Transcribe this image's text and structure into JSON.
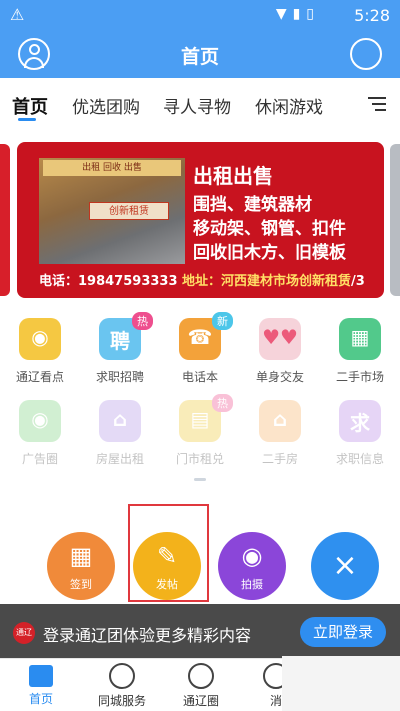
{
  "status": {
    "time": "5:28"
  },
  "header": {
    "title": "首页"
  },
  "tabs": [
    {
      "label": "首页",
      "active": true
    },
    {
      "label": "优选团购"
    },
    {
      "label": "寻人寻物"
    },
    {
      "label": "休闲游戏"
    }
  ],
  "banner": {
    "sign_text": "出租 回收 出售",
    "photo_sign": "创新租赁",
    "headline": "出租出售",
    "lines": [
      "围挡、建筑器材",
      "移动架、钢管、扣件",
      "回收旧木方、旧模板"
    ],
    "phone": "电话：19847593333",
    "address": "地址：河西建材市场创新租赁",
    "page": "/3"
  },
  "grid": [
    {
      "label": "通辽看点",
      "badge": ""
    },
    {
      "label": "求职招聘",
      "badge": "热"
    },
    {
      "label": "电话本",
      "badge": "新"
    },
    {
      "label": "单身交友",
      "badge": ""
    },
    {
      "label": "二手市场",
      "badge": ""
    },
    {
      "label": "广告圈",
      "badge": ""
    },
    {
      "label": "房屋出租",
      "badge": ""
    },
    {
      "label": "门市租兑",
      "badge": "热"
    },
    {
      "label": "二手房",
      "badge": ""
    },
    {
      "label": "求职信息",
      "badge": ""
    }
  ],
  "fab": {
    "checkin": "签到",
    "post": "发帖",
    "shoot": "拍摄",
    "close_symbol": "×"
  },
  "loginbar": {
    "logo": "通辽",
    "text": "登录通辽团体验更多精彩内容",
    "button": "立即登录"
  },
  "bottomnav": [
    "首页",
    "同城服务",
    "通辽圈",
    "消"
  ],
  "colors": {
    "primary": "#4b9ef3",
    "banner_red": "#c8131f",
    "login_btn": "#2f8ef0"
  }
}
